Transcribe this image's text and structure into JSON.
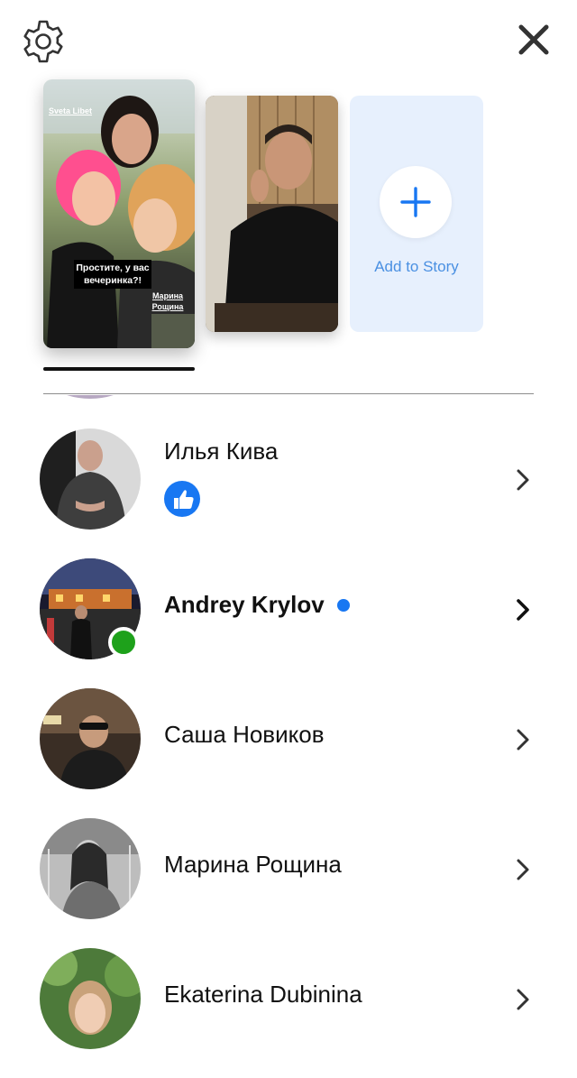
{
  "header": {
    "settings_icon": "gear-icon",
    "close_icon": "close-icon"
  },
  "stories": {
    "first": {
      "author": "Sveta Libet",
      "caption": "Простите, у вас вечеринка?!",
      "mention": "Марина Рощина"
    },
    "add_label": "Add to Story"
  },
  "contacts": [
    {
      "name": "Илья Кива",
      "status": "liked",
      "online": false,
      "unread": false
    },
    {
      "name": "Andrey Krylov",
      "status": "unread",
      "online": true,
      "unread": true
    },
    {
      "name": "Саша Новиков",
      "status": "",
      "online": false,
      "unread": false
    },
    {
      "name": "Марина Рощина",
      "status": "",
      "online": false,
      "unread": false
    },
    {
      "name": "Ekaterina Dubinina",
      "status": "",
      "online": false,
      "unread": false
    }
  ],
  "colors": {
    "accent": "#4a90e2",
    "messenger_blue": "#1877f2",
    "online_green": "#1ea11b",
    "add_card_bg": "#e7f0fd"
  }
}
